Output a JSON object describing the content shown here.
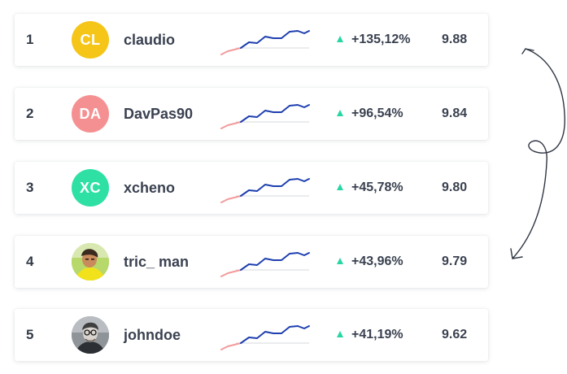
{
  "colors": {
    "trend_up": "#26d6a3",
    "sparkline_recent": "#1e3faf",
    "sparkline_old": "#f39b9b",
    "baseline": "#d6d9de"
  },
  "leaderboard": {
    "rows": [
      {
        "rank": "1",
        "avatar": {
          "type": "initials",
          "initials": "CL",
          "color": "#f5c518"
        },
        "username": "claudio",
        "change": "+135,12%",
        "score": "9.88",
        "trend": "up"
      },
      {
        "rank": "2",
        "avatar": {
          "type": "initials",
          "initials": "DA",
          "color": "#f59092"
        },
        "username": "DavPas90",
        "change": "+96,54%",
        "score": "9.84",
        "trend": "up"
      },
      {
        "rank": "3",
        "avatar": {
          "type": "initials",
          "initials": "XC",
          "color": "#2ee0a4"
        },
        "username": "xcheno",
        "change": "+45,78%",
        "score": "9.80",
        "trend": "up"
      },
      {
        "rank": "4",
        "avatar": {
          "type": "photo",
          "icon": "user-photo-yellow-shirt"
        },
        "username": "tric_ man",
        "change": "+43,96%",
        "score": "9.79",
        "trend": "up"
      },
      {
        "rank": "5",
        "avatar": {
          "type": "photo",
          "icon": "user-photo-glasses"
        },
        "username": "johndoe",
        "change": "+41,19%",
        "score": "9.62",
        "trend": "up"
      }
    ]
  }
}
